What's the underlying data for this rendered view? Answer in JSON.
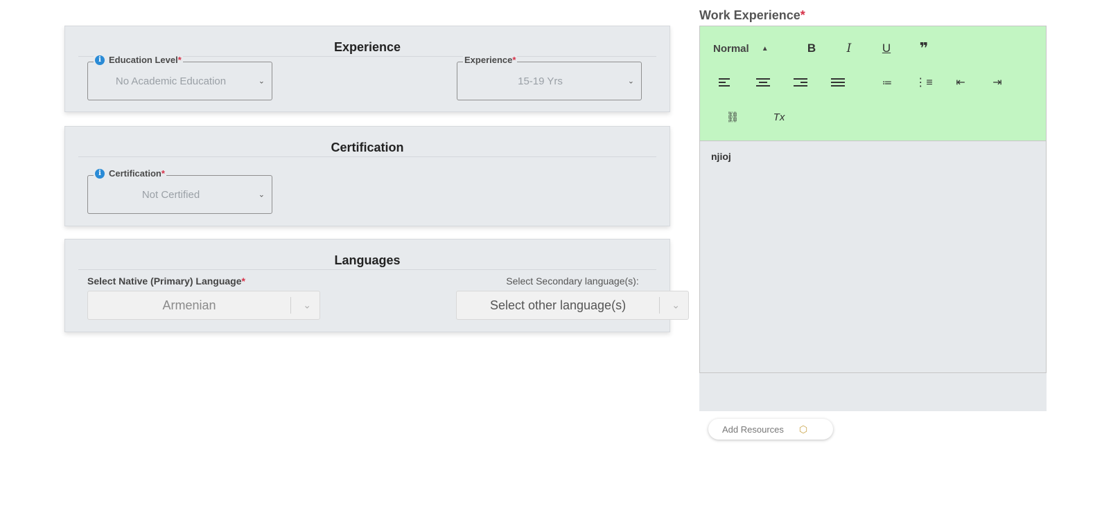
{
  "experience_card": {
    "title": "Experience",
    "education_level": {
      "label": "Education Level",
      "required": "*",
      "value": "No Academic Education"
    },
    "experience": {
      "label": "Experience",
      "required": "*",
      "value": "15-19 Yrs"
    }
  },
  "certification_card": {
    "title": "Certification",
    "certification": {
      "label": "Certification",
      "required": "*",
      "value": "Not Certified"
    }
  },
  "languages_card": {
    "title": "Languages",
    "native": {
      "label": "Select Native (Primary) Language",
      "required": "*",
      "value": "Armenian"
    },
    "secondary": {
      "label": "Select Secondary language(s):",
      "placeholder": "Select other language(s)"
    }
  },
  "work_experience": {
    "label": "Work Experience",
    "required": "*",
    "toolbar": {
      "format": "Normal",
      "bold": "B",
      "italic": "I",
      "underline": "U",
      "quote": "❞",
      "link": "⛓",
      "clear_format": "Tx"
    },
    "content": "njioj"
  },
  "add_resources": {
    "label": "Add Resources",
    "icon": "hexagon-icon"
  },
  "colors": {
    "toolbar_bg": "#c2f5c2",
    "required": "#d6334a",
    "info": "#2a8bd6",
    "card_bg": "#e7eaed"
  }
}
